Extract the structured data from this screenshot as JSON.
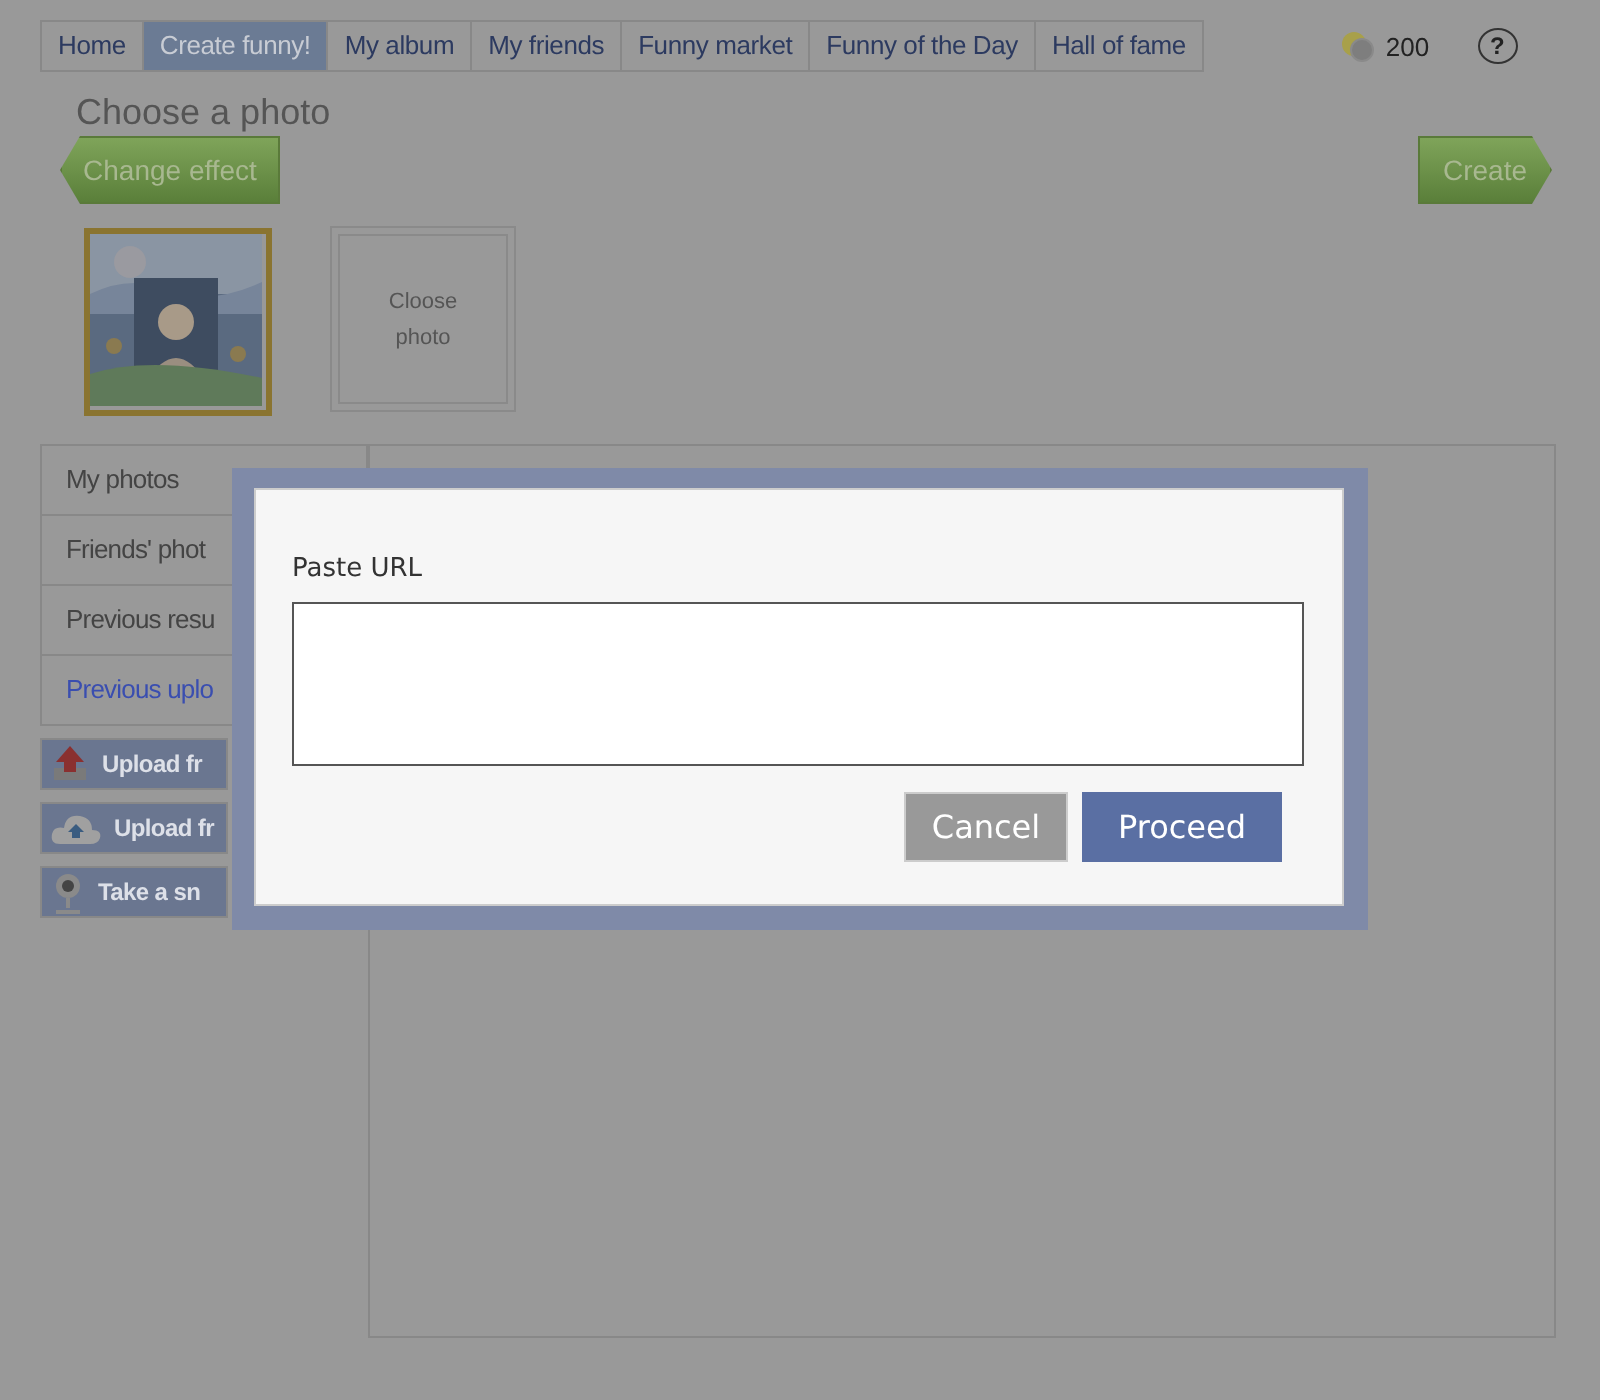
{
  "tabs": [
    {
      "label": "Home",
      "selected": false
    },
    {
      "label": "Create funny!",
      "selected": true
    },
    {
      "label": "My album",
      "selected": false
    },
    {
      "label": "My friends",
      "selected": false
    },
    {
      "label": "Funny market",
      "selected": false
    },
    {
      "label": "Funny of the Day",
      "selected": false
    },
    {
      "label": "Hall of fame",
      "selected": false
    }
  ],
  "coins": "200",
  "help": "?",
  "heading": "Choose a photo",
  "change_effect": "Change effect",
  "create": "Create",
  "photos": [
    {
      "kind": "picture"
    },
    {
      "kind": "close",
      "label": "Cloose photo"
    }
  ],
  "sources": [
    {
      "label": "My photos",
      "selected": false
    },
    {
      "label": "Friends' phot",
      "selected": false
    },
    {
      "label": "Previous resu",
      "selected": false
    },
    {
      "label": "Previous uplo",
      "selected": true
    }
  ],
  "uploads": [
    {
      "kind": "disk",
      "label": "Upload fr"
    },
    {
      "kind": "cloud",
      "label": "Upload fr"
    },
    {
      "kind": "webcam",
      "label": "Take a sn"
    }
  ],
  "dialog": {
    "label": "Paste URL",
    "buttons": [
      {
        "kind": "cancel",
        "label": "Cancel"
      },
      {
        "kind": "proceed",
        "label": "Proceed"
      }
    ]
  }
}
